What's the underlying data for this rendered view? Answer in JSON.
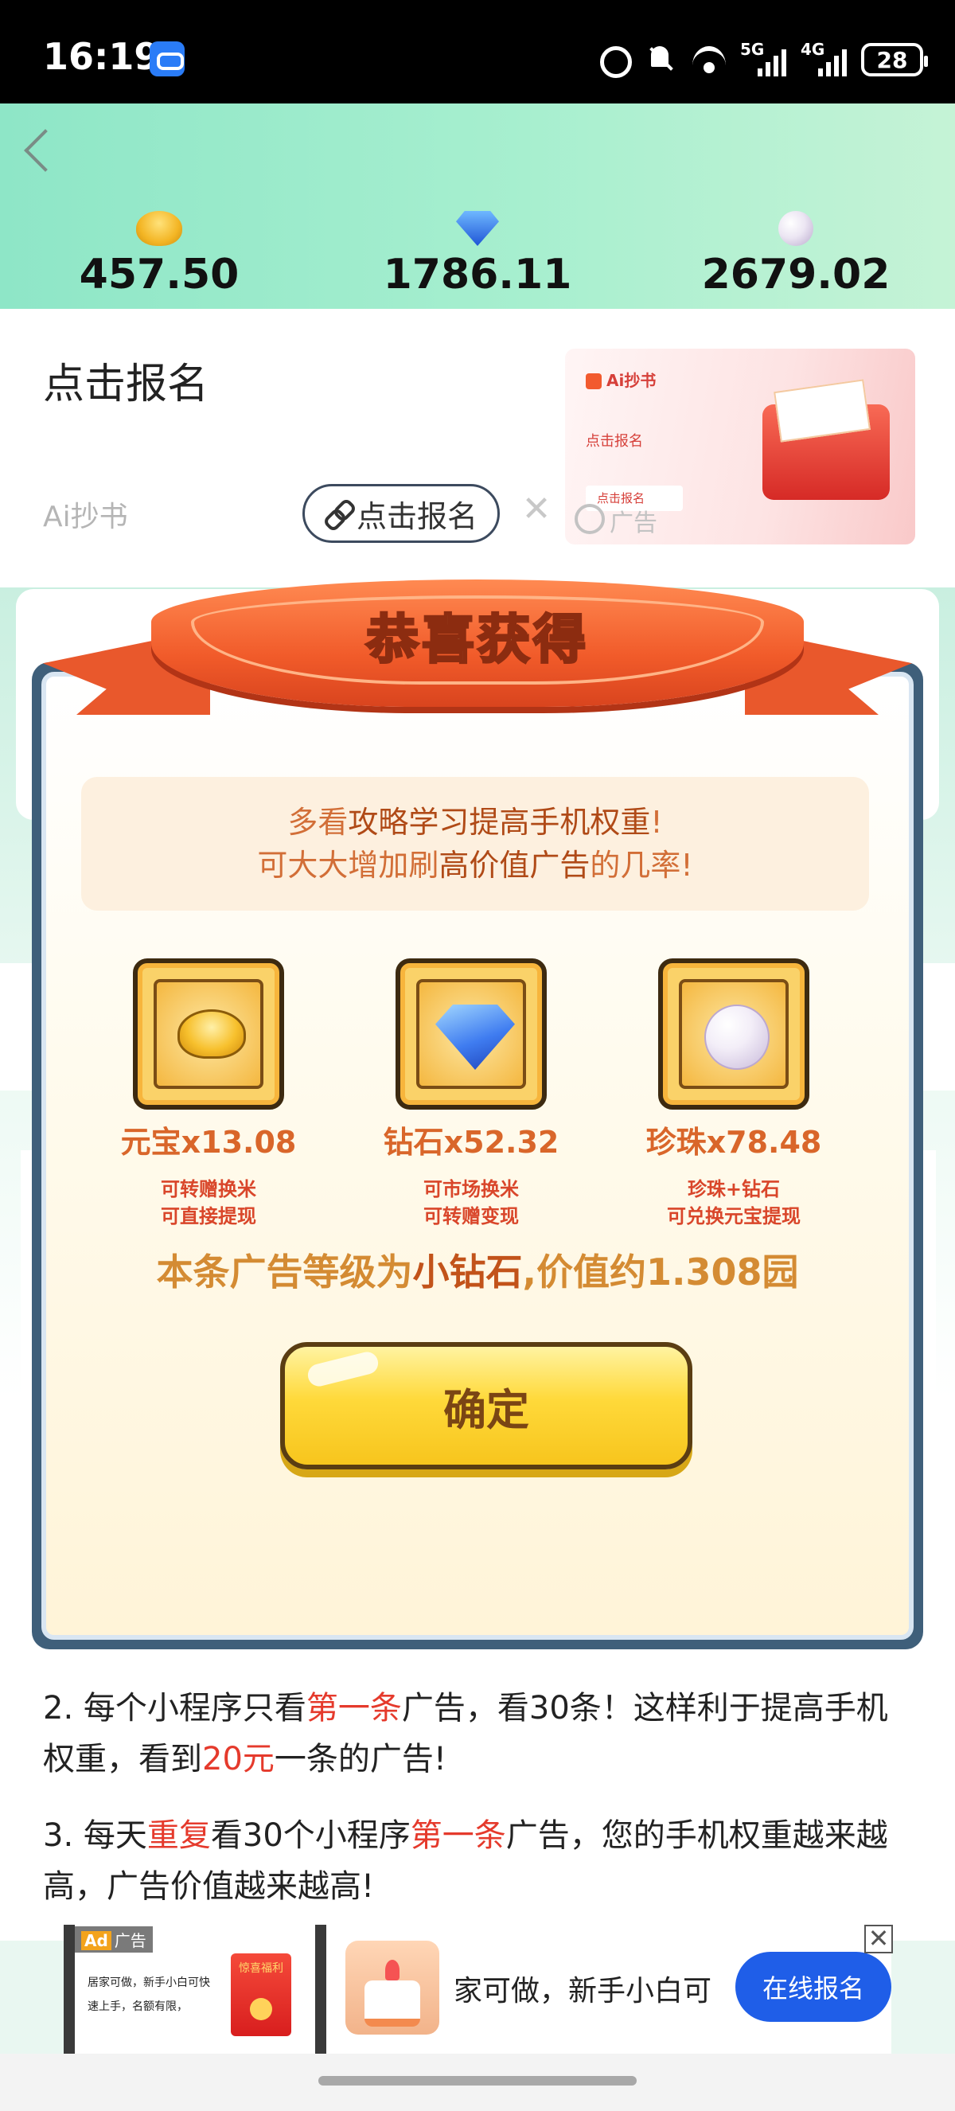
{
  "status_bar": {
    "time": "16:19",
    "net1": "5G",
    "net2": "4G",
    "battery": "28"
  },
  "balances": [
    {
      "icon": "gold-ingot-icon",
      "value": "457.50"
    },
    {
      "icon": "diamond-icon",
      "value": "1786.11"
    },
    {
      "icon": "pearl-icon",
      "value": "2679.02"
    }
  ],
  "top_ad": {
    "title": "点击报名",
    "source": "Ai抄书",
    "button": "点击报名",
    "close": "✕",
    "tag": "广告",
    "thumb_brand": "Ai抄书",
    "thumb_sub": "点击报名",
    "thumb_button": "点击报名"
  },
  "modal": {
    "title": "恭喜获得",
    "tip_line1_a": "多看",
    "tip_line1_b": "攻略学习提高手机权重",
    "tip_line1_c": "!",
    "tip_line2_a": "可大大增加刷",
    "tip_line2_b": "高价值广告",
    "tip_line2_c": "的几率!",
    "rewards": [
      {
        "name": "元宝x13.08",
        "desc1": "可转赠换米",
        "desc2": "可直接提现"
      },
      {
        "name": "钻石x52.32",
        "desc1": "可市场换米",
        "desc2": "可转赠变现"
      },
      {
        "name": "珍珠x78.48",
        "desc1": "珍珠+钻石",
        "desc2": "可兑换元宝提现"
      }
    ],
    "level_a": "本条广告等级为",
    "level_b": "小钻石",
    "level_c": ",价值约1.308园",
    "confirm": "确定"
  },
  "article": {
    "p2_a": "2. 每个小程序只看",
    "p2_b": "第一条",
    "p2_c": "广告，看30条！这样利于提高手机权重，看到",
    "p2_d": "20元",
    "p2_e": "一条的广告!",
    "p3_a": "3. 每天",
    "p3_b": "重复",
    "p3_c": "看30个小程序",
    "p3_d": "第一条",
    "p3_e": "广告，您的手机权重越来越高，广告价值越来越高!"
  },
  "bottom_ad": {
    "ad_mark": "Ad",
    "tag": "广告",
    "text": "居家可做，新手小白可快速上手，名额有限，",
    "pack": "惊喜福利",
    "marquee": "家可做，新手小白可",
    "cta": "在线报名",
    "close": "✕"
  }
}
